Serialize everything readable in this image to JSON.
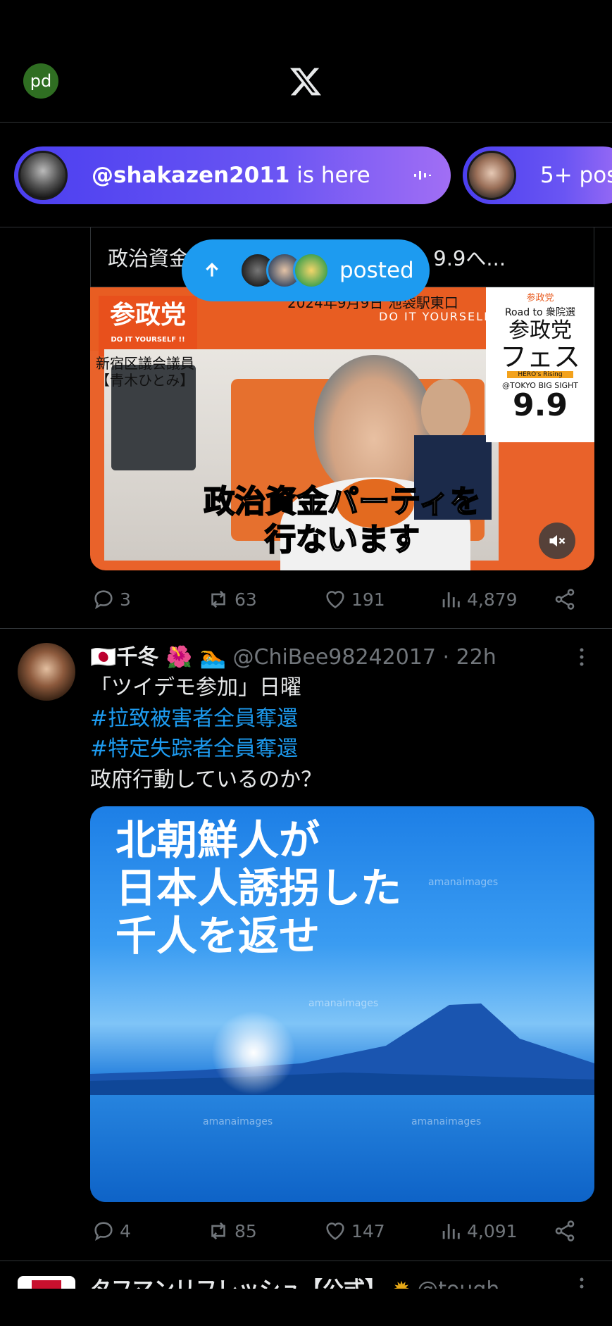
{
  "header": {
    "user_initials": "pd",
    "logo_icon": "x-logo-icon"
  },
  "spaces": [
    {
      "handle": "@shakazen2011",
      "suffix": "is here"
    },
    {
      "text": "5+ pos"
    }
  ],
  "posted_pill": {
    "label": "posted"
  },
  "tweet1": {
    "card_title": "政治資金パーティ「参政党フェス」9.9へ...",
    "overlay_party": "参政党",
    "overlay_motto": "DO IT YOURSELF !!",
    "overlay_banner": "2024年9月9日 池袋駅東口",
    "overlay_banner2": "DO IT YOURSELF",
    "overlay_speaker": "新宿区議会議員\n【青木ひとみ】",
    "overlay_caption1": "政治資金パーティを",
    "overlay_caption2": "行ないます",
    "poster_top": "参政党",
    "poster_road": "Road to 衆院選",
    "poster_party": "参政党",
    "poster_fes": "フェス",
    "poster_hero": "HERO's Rising",
    "poster_venue": "@TOKYO BIG SIGHT",
    "poster_date": "9.9",
    "stats": {
      "replies": "3",
      "reposts": "63",
      "likes": "191",
      "views": "4,879"
    }
  },
  "tweet2": {
    "name": "🇯🇵千冬 🌺 🏊",
    "handle": "@ChiBee98242017",
    "sep": " · ",
    "time": "22h",
    "line1": "「ツイデモ参加」日曜",
    "hashtag1": "#拉致被害者全員奪還",
    "hashtag2": "#特定失踪者全員奪還",
    "line4": "政府行動しているのか？",
    "image_text1": "北朝鮮人が",
    "image_text2": "日本人誘拐した",
    "image_text3": "千人を返せ",
    "watermark": "amanaimages",
    "stats": {
      "replies": "4",
      "reposts": "85",
      "likes": "147",
      "views": "4,091"
    }
  },
  "tweet3": {
    "name": "タフマンリフレッシュ【公式】",
    "handle": "@tough"
  }
}
